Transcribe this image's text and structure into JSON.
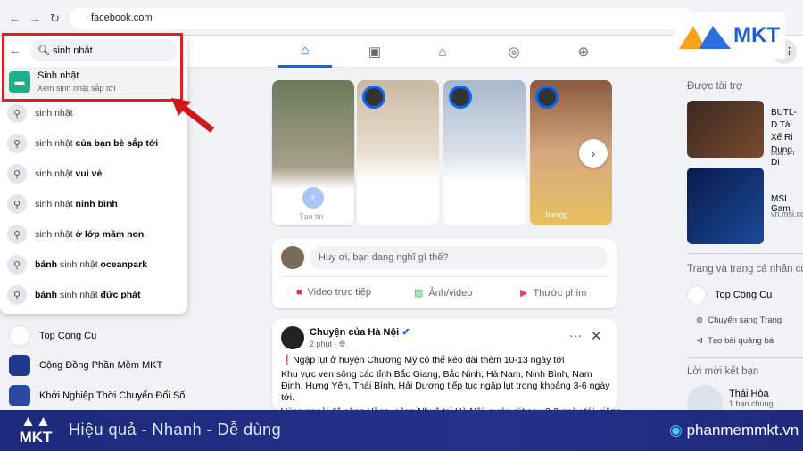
{
  "browser": {
    "url": "facebook.com"
  },
  "search": {
    "query": "sinh nhật",
    "top_result": {
      "title": "Sinh nhật",
      "subtitle": "Xem sinh nhật sắp tới"
    },
    "suggestions": [
      {
        "plain": "sinh nhật",
        "bold": ""
      },
      {
        "plain": "sinh nhật ",
        "bold": "của bạn bè sắp tới"
      },
      {
        "plain": "sinh nhật ",
        "bold": "vui vẻ"
      },
      {
        "plain": "sinh nhật ",
        "bold": "ninh bình"
      },
      {
        "plain": "sinh nhật ",
        "bold": "ở lớp mầm non"
      },
      {
        "pre": "bánh",
        "plain": " sinh nhật ",
        "bold": "oceanpark"
      },
      {
        "pre": "bánh",
        "plain": " sinh nhật ",
        "bold": "đức phát"
      }
    ]
  },
  "shortcuts": [
    {
      "label": "Top Công Cụ"
    },
    {
      "label": "Cộng Đồng Phần Mềm MKT"
    },
    {
      "label": "Khởi Nghiệp Thời Chuyển Đổi Số"
    }
  ],
  "stories": {
    "create_label": "Tạo tin",
    "last_name": "...hangg"
  },
  "composer": {
    "placeholder": "Huy ơi, bạn đang nghĩ gì thế?",
    "actions": [
      "Video trực tiếp",
      "Ảnh/video",
      "Thước phim"
    ]
  },
  "post": {
    "author": "Chuyện của Hà Nội",
    "time": "2 phút ·",
    "title": "Ngập lụt ở huyện Chương Mỹ có thể kéo dài thêm 10-13 ngày tới",
    "body1": "Khu vực ven sông các tỉnh Bắc Giang, Bắc Ninh, Hà Nam, Ninh Bình, Nam Định, Hưng Yên, Thái Bình, Hải Dương tiếp tục ngập lụt trong khoảng 3-6 ngày tới.",
    "body2": "Vùng ngoài đê sông Hồng, sông Nhuệ tại Hà Nội, nước rút sau 2-3 ngày tới, riêng"
  },
  "right": {
    "sponsored": "Được tài trợ",
    "ads": [
      {
        "title": "BUTL- D Tài Xế Ri Dụng Di",
        "domain": "butl.vn"
      },
      {
        "title": "MSI Gam",
        "domain": "vn.msi.com"
      }
    ],
    "pages_heading": "Trang và trang cá nhân củ",
    "page_name": "Top Công Cụ",
    "switch": "Chuyển sang Trang",
    "promote": "Tạo bài quảng bá",
    "friend_heading": "Lời mời kết bạn",
    "friend_name": "Thái Hòa",
    "mutual": "1 bạn chung"
  },
  "banner": {
    "logo": "MKT",
    "slogan": "Hiệu quả - Nhanh  - Dễ dùng",
    "site": "phanmemmkt.vn"
  },
  "colors": {
    "accent": "#0866ff",
    "highlight": "#e02020",
    "banner": "#1f2a7a"
  }
}
